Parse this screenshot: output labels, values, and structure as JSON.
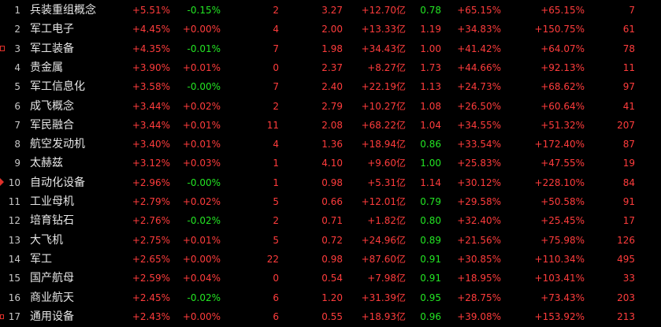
{
  "board": {
    "colors": {
      "up": "#ff3c3c",
      "down": "#23e523",
      "text": "#e6e6e6",
      "background": "#000000"
    },
    "rows": [
      {
        "index": "1",
        "name": "兵装重组概念",
        "change": "+5.51%",
        "speed": "-0.15%",
        "up_count": "2",
        "ratio": "3.27",
        "amount": "+12.70亿",
        "turnover": "0.78",
        "ytd": "+65.15%",
        "yearly": "+65.15%",
        "count": "7",
        "change_dir": "up",
        "speed_dir": "down",
        "turnover_dir": "down",
        "marker": "none"
      },
      {
        "index": "2",
        "name": "军工电子",
        "change": "+4.45%",
        "speed": "+0.00%",
        "up_count": "4",
        "ratio": "2.00",
        "amount": "+13.33亿",
        "turnover": "1.19",
        "ytd": "+34.83%",
        "yearly": "+150.75%",
        "count": "61",
        "change_dir": "up",
        "speed_dir": "up",
        "turnover_dir": "up",
        "marker": "none"
      },
      {
        "index": "3",
        "name": "军工装备",
        "change": "+4.35%",
        "speed": "-0.01%",
        "up_count": "7",
        "ratio": "1.98",
        "amount": "+34.43亿",
        "turnover": "1.00",
        "ytd": "+41.42%",
        "yearly": "+64.07%",
        "count": "78",
        "change_dir": "up",
        "speed_dir": "down",
        "turnover_dir": "up",
        "marker": "box"
      },
      {
        "index": "4",
        "name": "贵金属",
        "change": "+3.90%",
        "speed": "+0.01%",
        "up_count": "0",
        "ratio": "2.37",
        "amount": "+8.27亿",
        "turnover": "1.73",
        "ytd": "+44.66%",
        "yearly": "+92.13%",
        "count": "11",
        "change_dir": "up",
        "speed_dir": "up",
        "turnover_dir": "up",
        "marker": "none"
      },
      {
        "index": "5",
        "name": "军工信息化",
        "change": "+3.58%",
        "speed": "-0.00%",
        "up_count": "7",
        "ratio": "2.40",
        "amount": "+22.19亿",
        "turnover": "1.13",
        "ytd": "+24.73%",
        "yearly": "+68.62%",
        "count": "97",
        "change_dir": "up",
        "speed_dir": "down",
        "turnover_dir": "up",
        "marker": "none"
      },
      {
        "index": "6",
        "name": "成飞概念",
        "change": "+3.44%",
        "speed": "+0.02%",
        "up_count": "2",
        "ratio": "2.79",
        "amount": "+10.27亿",
        "turnover": "1.08",
        "ytd": "+26.50%",
        "yearly": "+60.64%",
        "count": "41",
        "change_dir": "up",
        "speed_dir": "up",
        "turnover_dir": "up",
        "marker": "none"
      },
      {
        "index": "7",
        "name": "军民融合",
        "change": "+3.44%",
        "speed": "+0.01%",
        "up_count": "11",
        "ratio": "2.08",
        "amount": "+68.22亿",
        "turnover": "1.04",
        "ytd": "+34.55%",
        "yearly": "+51.32%",
        "count": "207",
        "change_dir": "up",
        "speed_dir": "up",
        "turnover_dir": "up",
        "marker": "none"
      },
      {
        "index": "8",
        "name": "航空发动机",
        "change": "+3.40%",
        "speed": "+0.01%",
        "up_count": "4",
        "ratio": "1.36",
        "amount": "+18.94亿",
        "turnover": "0.86",
        "ytd": "+33.54%",
        "yearly": "+172.40%",
        "count": "87",
        "change_dir": "up",
        "speed_dir": "up",
        "turnover_dir": "down",
        "marker": "none"
      },
      {
        "index": "9",
        "name": "太赫兹",
        "change": "+3.12%",
        "speed": "+0.03%",
        "up_count": "1",
        "ratio": "4.10",
        "amount": "+9.60亿",
        "turnover": "1.00",
        "ytd": "+25.83%",
        "yearly": "+47.55%",
        "count": "19",
        "change_dir": "up",
        "speed_dir": "up",
        "turnover_dir": "down",
        "marker": "none"
      },
      {
        "index": "10",
        "name": "自动化设备",
        "change": "+2.96%",
        "speed": "-0.00%",
        "up_count": "1",
        "ratio": "0.98",
        "amount": "+5.31亿",
        "turnover": "1.14",
        "ytd": "+30.12%",
        "yearly": "+228.10%",
        "count": "84",
        "change_dir": "up",
        "speed_dir": "down",
        "turnover_dir": "up",
        "marker": "arrow"
      },
      {
        "index": "11",
        "name": "工业母机",
        "change": "+2.79%",
        "speed": "+0.02%",
        "up_count": "5",
        "ratio": "0.66",
        "amount": "+12.01亿",
        "turnover": "0.79",
        "ytd": "+29.58%",
        "yearly": "+50.58%",
        "count": "91",
        "change_dir": "up",
        "speed_dir": "up",
        "turnover_dir": "down",
        "marker": "none"
      },
      {
        "index": "12",
        "name": "培育钻石",
        "change": "+2.76%",
        "speed": "-0.02%",
        "up_count": "2",
        "ratio": "0.71",
        "amount": "+1.82亿",
        "turnover": "0.80",
        "ytd": "+32.40%",
        "yearly": "+25.45%",
        "count": "17",
        "change_dir": "up",
        "speed_dir": "down",
        "turnover_dir": "down",
        "marker": "none"
      },
      {
        "index": "13",
        "name": "大飞机",
        "change": "+2.75%",
        "speed": "+0.01%",
        "up_count": "5",
        "ratio": "0.72",
        "amount": "+24.96亿",
        "turnover": "0.89",
        "ytd": "+21.56%",
        "yearly": "+75.98%",
        "count": "126",
        "change_dir": "up",
        "speed_dir": "up",
        "turnover_dir": "down",
        "marker": "none"
      },
      {
        "index": "14",
        "name": "军工",
        "change": "+2.65%",
        "speed": "+0.00%",
        "up_count": "22",
        "ratio": "0.98",
        "amount": "+87.60亿",
        "turnover": "0.91",
        "ytd": "+30.85%",
        "yearly": "+110.34%",
        "count": "495",
        "change_dir": "up",
        "speed_dir": "up",
        "turnover_dir": "down",
        "marker": "none"
      },
      {
        "index": "15",
        "name": "国产航母",
        "change": "+2.59%",
        "speed": "+0.04%",
        "up_count": "0",
        "ratio": "0.54",
        "amount": "+7.98亿",
        "turnover": "0.91",
        "ytd": "+18.95%",
        "yearly": "+103.41%",
        "count": "33",
        "change_dir": "up",
        "speed_dir": "up",
        "turnover_dir": "down",
        "marker": "none"
      },
      {
        "index": "16",
        "name": "商业航天",
        "change": "+2.45%",
        "speed": "-0.02%",
        "up_count": "6",
        "ratio": "1.20",
        "amount": "+31.39亿",
        "turnover": "0.95",
        "ytd": "+28.75%",
        "yearly": "+73.43%",
        "count": "203",
        "change_dir": "up",
        "speed_dir": "down",
        "turnover_dir": "down",
        "marker": "none"
      },
      {
        "index": "17",
        "name": "通用设备",
        "change": "+2.43%",
        "speed": "+0.00%",
        "up_count": "6",
        "ratio": "0.55",
        "amount": "+18.93亿",
        "turnover": "0.96",
        "ytd": "+39.08%",
        "yearly": "+153.92%",
        "count": "213",
        "change_dir": "up",
        "speed_dir": "up",
        "turnover_dir": "down",
        "marker": "box-small"
      }
    ]
  }
}
